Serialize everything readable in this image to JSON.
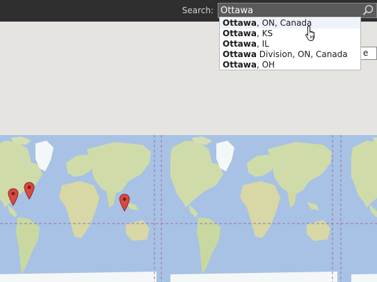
{
  "search": {
    "label": "Search:",
    "value": "Ottawa",
    "button_icon": "search-icon"
  },
  "side_button": {
    "label": "e"
  },
  "suggestions": [
    {
      "bold": "Ottawa",
      "rest": ", ON, Canada"
    },
    {
      "bold": "Ottawa",
      "rest": ", KS"
    },
    {
      "bold": "Ottawa",
      "rest": ", IL"
    },
    {
      "bold": "Ottawa",
      "rest": " Division, ON, Canada"
    },
    {
      "bold": "Ottawa",
      "rest": ", OH"
    }
  ],
  "map": {
    "marker_icon": "map-pin-icon",
    "colors": {
      "ocean": "#a7c2e4",
      "land": "#cfdcaa",
      "ice": "#f4f7f8",
      "marker": "#d74a3e",
      "border": "#a070a0"
    }
  },
  "cursor_icon": "hand-pointer-icon"
}
